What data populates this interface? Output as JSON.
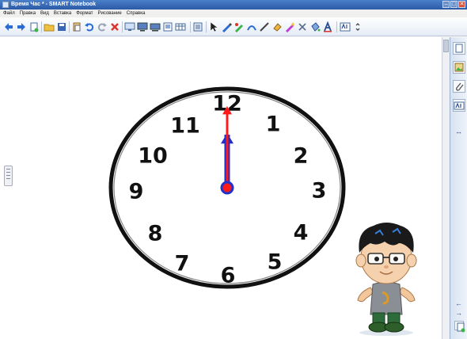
{
  "window": {
    "title": "Время Час * - SMART Notebook",
    "buttons": {
      "minimize": "–",
      "maximize": "□",
      "close": "✕"
    }
  },
  "menu": [
    "Файл",
    "Правка",
    "Вид",
    "Вставка",
    "Формат",
    "Рисование",
    "Справка"
  ],
  "toolbar_icons": [
    "back-arrow-icon",
    "forward-arrow-icon",
    "new-page-icon",
    "open-folder-icon",
    "save-icon",
    "paste-icon",
    "undo-icon",
    "redo-icon",
    "delete-icon",
    "screen-shade-icon",
    "display-icon",
    "document-camera-icon",
    "screen-capture-icon",
    "table-icon",
    "select-icon",
    "pen-icon",
    "creative-pen-icon",
    "shape-icon",
    "line-icon",
    "eraser-icon",
    "magic-pen-icon",
    "fill-icon",
    "text-icon",
    "properties-icon",
    "more-icon"
  ],
  "clock": {
    "numbers": [
      "12",
      "1",
      "2",
      "3",
      "4",
      "5",
      "6",
      "7",
      "8",
      "9",
      "10",
      "11"
    ],
    "time": {
      "hour": 12,
      "minute": 0
    },
    "colors": {
      "minute_hand": "#ff1a1a",
      "hour_hand": "#1f2ec7",
      "center": "#2233cc",
      "face": "#111111"
    }
  },
  "sidebar": {
    "icons": [
      "page-sorter-icon",
      "gallery-icon",
      "attachments-icon",
      "properties-icon"
    ],
    "collapse_glyph": "↔",
    "nav_glyphs": {
      "previous": "←",
      "next": "→"
    }
  }
}
